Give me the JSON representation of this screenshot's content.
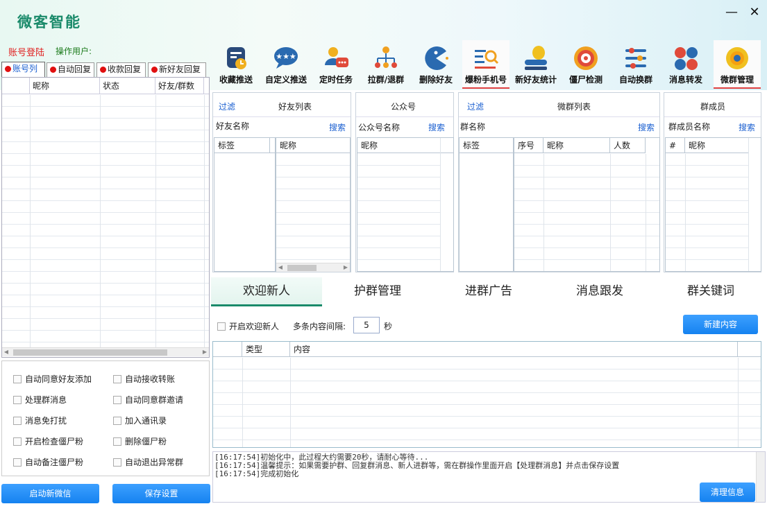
{
  "app": {
    "title": "微客智能"
  },
  "window": {
    "minimize_icon": "minimize-icon",
    "close_icon": "close-icon"
  },
  "account": {
    "login": "账号登陆",
    "operator_label": "操作用户:"
  },
  "left_tabs": [
    "账号列",
    "自动回复",
    "收款回复",
    "新好友回复"
  ],
  "account_grid": {
    "columns": [
      "",
      "昵称",
      "状态",
      "好友/群数"
    ]
  },
  "options": [
    [
      "自动同意好友添加",
      "自动接收转账"
    ],
    [
      "处理群消息",
      "自动同意群邀请"
    ],
    [
      "消息免打扰",
      "加入通讯录"
    ],
    [
      "开启检查僵尸粉",
      "删除僵尸粉"
    ],
    [
      "自动备注僵尸粉",
      "自动退出异常群"
    ]
  ],
  "buttons": {
    "start_wechat": "启动新微信",
    "save_settings": "保存设置",
    "new_content": "新建内容",
    "clear_info": "清理信息"
  },
  "toolbar": [
    {
      "label": "收藏推送",
      "icon": "favorite-push-icon",
      "color": "#2a4a7a"
    },
    {
      "label": "自定义推送",
      "icon": "chat-custom-icon",
      "color": "#2a6ab0"
    },
    {
      "label": "定时任务",
      "icon": "user-timer-icon",
      "color": "#e04a3a"
    },
    {
      "label": "拉群/退群",
      "icon": "group-tree-icon",
      "color": "#f0a020"
    },
    {
      "label": "删除好友",
      "icon": "pacman-icon",
      "color": "#2a6ab0"
    },
    {
      "label": "爆粉手机号",
      "icon": "search-list-icon",
      "color": "#f0a020"
    },
    {
      "label": "新好友统计",
      "icon": "user-stat-icon",
      "color": "#f0c020"
    },
    {
      "label": "僵尸检测",
      "icon": "target-icon",
      "color": "#e04a3a"
    },
    {
      "label": "自动换群",
      "icon": "sliders-icon",
      "color": "#2a6ab0"
    },
    {
      "label": "消息转发",
      "icon": "dots-icon",
      "color": "#e04a3a"
    },
    {
      "label": "微群管理",
      "icon": "gear-icon",
      "color": "#f0c020"
    }
  ],
  "panels": {
    "friends": {
      "filter": "过滤",
      "title": "好友列表",
      "field": "好友名称",
      "search": "搜索",
      "col_tag": "标签",
      "col_nick": "昵称"
    },
    "official": {
      "title": "公众号",
      "field": "公众号名称",
      "search": "搜索",
      "col_nick": "昵称"
    },
    "groups": {
      "filter": "过滤",
      "title": "微群列表",
      "field": "群名称",
      "search": "搜索",
      "col_tag": "标签",
      "col_no": "序号",
      "col_nick": "昵称",
      "col_count": "人数"
    },
    "members": {
      "title": "群成员",
      "field": "群成员名称",
      "search": "搜索",
      "col_hash": "#",
      "col_nick": "昵称"
    }
  },
  "bottom_tabs": [
    "欢迎新人",
    "护群管理",
    "进群广告",
    "消息跟发",
    "群关键词"
  ],
  "welcome": {
    "enable_label": "开启欢迎新人",
    "interval_label": "多条内容间隔:",
    "interval_value": "5",
    "unit": "秒",
    "col_type": "类型",
    "col_content": "内容"
  },
  "log": [
    "[16:17:54]初始化中，此过程大约需要20秒，请耐心等待...",
    "[16:17:54]温馨提示：如果需要护群、回复群消息、新人进群等，需在群操作里面开启【处理群消息】并点击保存设置",
    "[16:17:54]完成初始化"
  ]
}
